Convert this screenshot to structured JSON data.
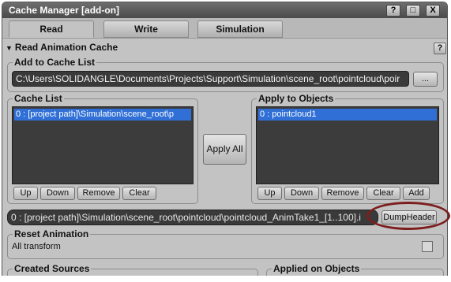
{
  "window": {
    "title": "Cache Manager [add-on]",
    "help_btn": "?",
    "max_btn": "□",
    "close_btn": "X"
  },
  "tabs": [
    {
      "label": "Read",
      "active": true
    },
    {
      "label": "Write",
      "active": false
    },
    {
      "label": "Simulation",
      "active": false
    }
  ],
  "section": {
    "title": "Read Animation Cache",
    "help": "?"
  },
  "add_to_cache": {
    "label": "Add to Cache List",
    "path": "C:\\Users\\SOLIDANGLE\\Documents\\Projects\\Support\\Simulation\\scene_root\\pointcloud\\poir",
    "browse_label": "..."
  },
  "cache_list": {
    "label": "Cache List",
    "items": [
      "0 : [project path]\\Simulation\\scene_root\\p"
    ],
    "buttons": {
      "up": "Up",
      "down": "Down",
      "remove": "Remove",
      "clear": "Clear"
    }
  },
  "apply_all_label": "Apply All",
  "apply_to_objects": {
    "label": "Apply to Objects",
    "items": [
      "0 : pointcloud1"
    ],
    "buttons": {
      "up": "Up",
      "down": "Down",
      "remove": "Remove",
      "clear": "Clear",
      "add": "Add"
    }
  },
  "cache_info": {
    "path": "0 : [project path]\\Simulation\\scene_root\\pointcloud\\pointcloud_AnimTake1_[1..100].i",
    "dump_header_label": "DumpHeader"
  },
  "reset_animation": {
    "label": "Reset Animation",
    "all_transform": "All transform",
    "checked": false
  },
  "created_sources_label": "Created Sources",
  "applied_on_objects_label": "Applied on Objects",
  "colors": {
    "selection": "#2f6fd6",
    "annotation": "#7d1e1e",
    "field_bg": "#3a3a3a"
  }
}
